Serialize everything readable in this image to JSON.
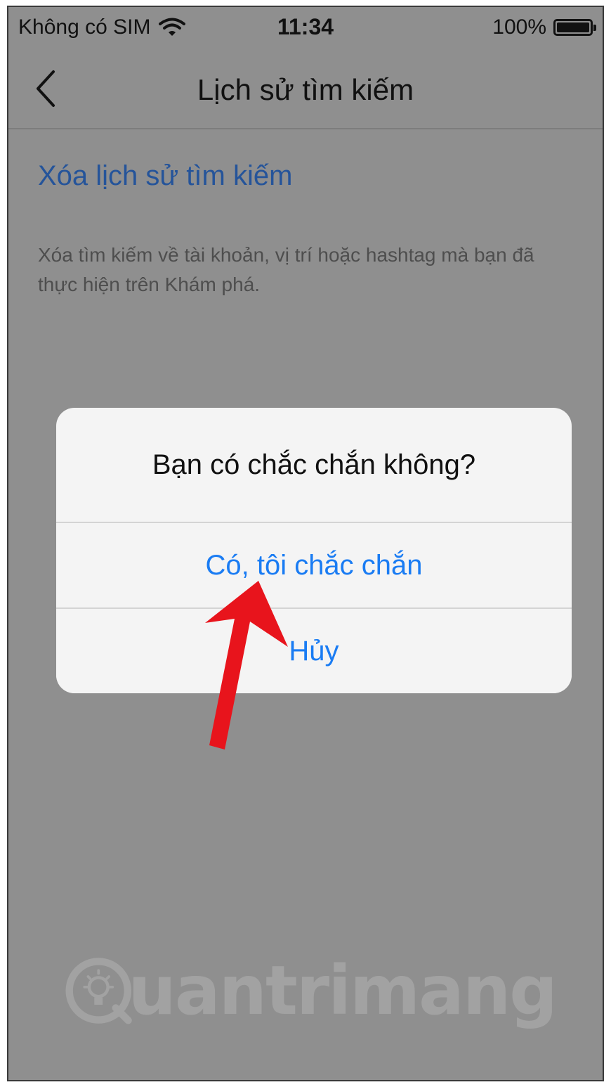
{
  "status_bar": {
    "carrier": "Không có SIM",
    "time": "11:34",
    "battery": "100%",
    "battery_level": 1.0
  },
  "nav": {
    "title": "Lịch sử tìm kiếm"
  },
  "content": {
    "clear_link": "Xóa lịch sử tìm kiếm",
    "description": "Xóa tìm kiếm về tài khoản, vị trí hoặc hashtag mà bạn đã thực hiện trên Khám phá."
  },
  "dialog": {
    "title": "Bạn có chắc chắn không?",
    "confirm_label": "Có, tôi chắc chắn",
    "cancel_label": "Hủy"
  },
  "watermark": {
    "brand": "uantrimang"
  },
  "icons": {
    "wifi": "wifi-icon",
    "battery": "battery-icon",
    "back": "chevron-left-icon",
    "arrow": "red-arrow-annotation-icon",
    "logo": "lightbulb-logo-icon"
  },
  "colors": {
    "link": "#25549a",
    "dialog_button": "#1a7cf3",
    "arrow": "#e8141c",
    "overlay": "#8f8f8f"
  }
}
